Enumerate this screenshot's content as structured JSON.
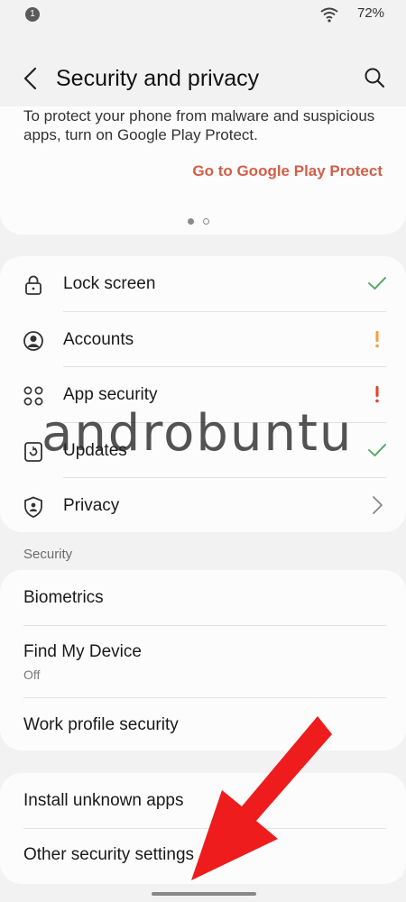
{
  "status_bar": {
    "notification_count": "1",
    "battery": "72%"
  },
  "header": {
    "title": "Security and privacy"
  },
  "banner": {
    "description": "To protect your phone from malware and suspicious apps, turn on Google Play Protect.",
    "link": "Go to Google Play Protect"
  },
  "main_list": [
    {
      "label": "Lock screen",
      "icon": "lock-icon",
      "status": "check"
    },
    {
      "label": "Accounts",
      "icon": "account-icon",
      "status": "warning"
    },
    {
      "label": "App security",
      "icon": "apps-icon",
      "status": "alert"
    },
    {
      "label": "Updates",
      "icon": "update-icon",
      "status": "check"
    },
    {
      "label": "Privacy",
      "icon": "privacy-shield-icon",
      "status": "chevron"
    }
  ],
  "security_section": {
    "heading": "Security",
    "items": [
      {
        "label": "Biometrics"
      },
      {
        "label": "Find My Device",
        "sub": "Off"
      },
      {
        "label": "Work profile security"
      }
    ]
  },
  "other_section": {
    "items": [
      {
        "label": "Install unknown apps"
      },
      {
        "label": "Other security settings"
      }
    ]
  },
  "watermark": "androbuntu",
  "colors": {
    "accent_link": "#d0604a",
    "check": "#5cab6a",
    "warning": "#f0a23a",
    "alert": "#e0452b",
    "arrow": "#ee1c1c"
  }
}
